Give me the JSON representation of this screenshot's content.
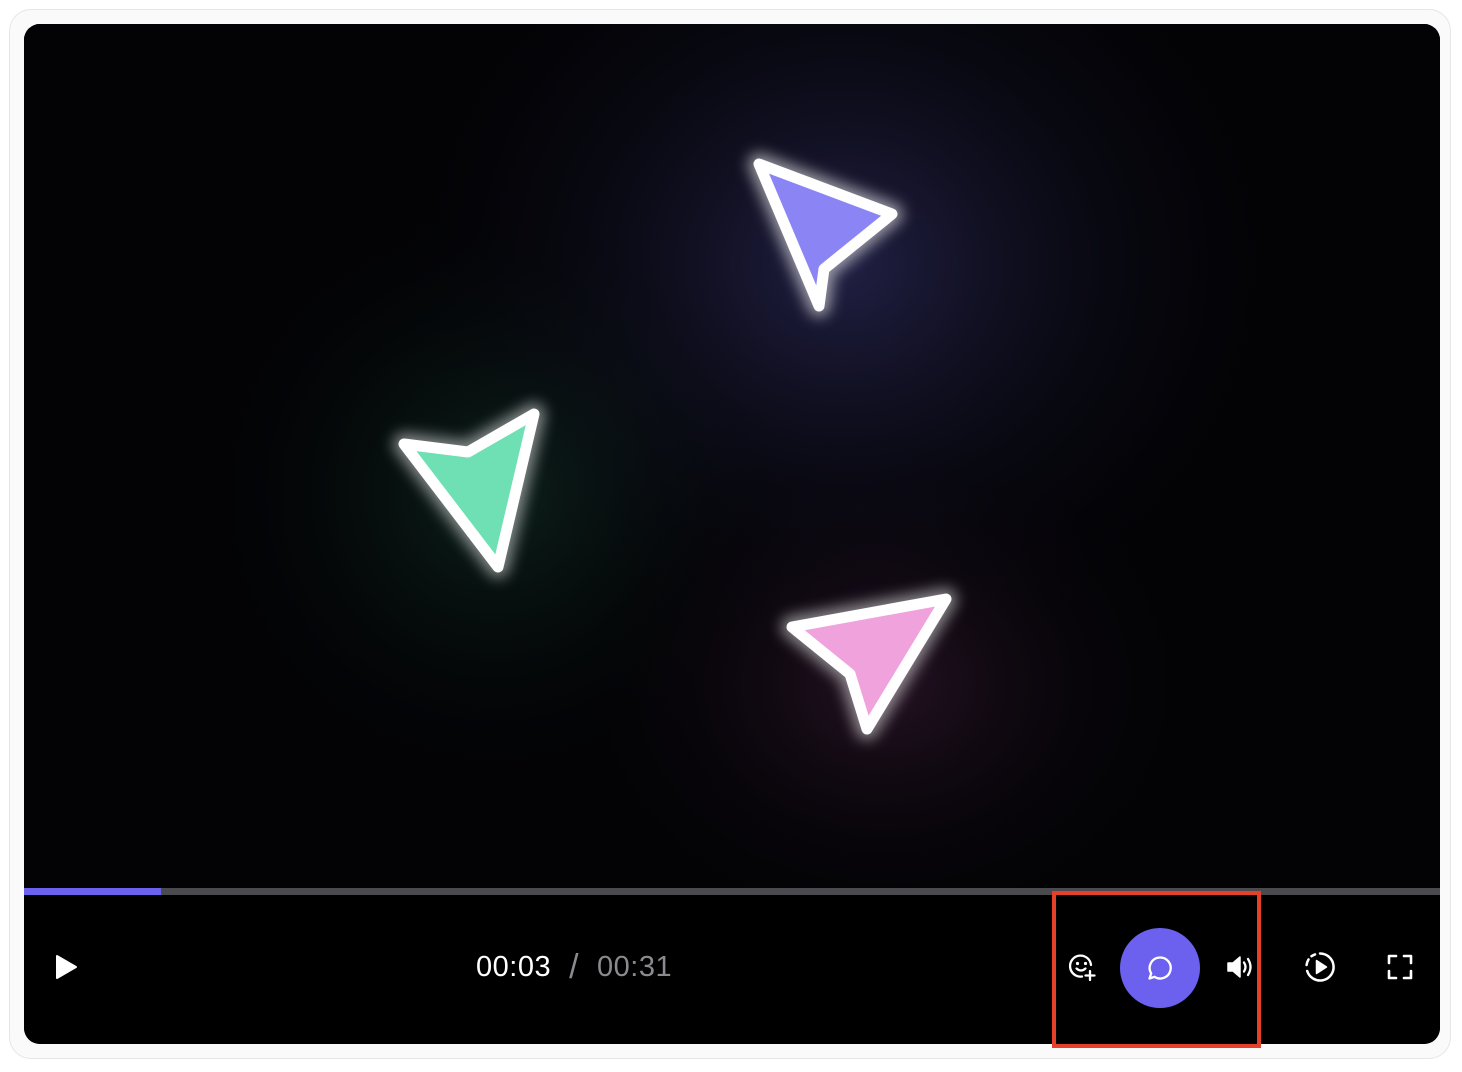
{
  "player": {
    "progress_fraction": 0.097,
    "accent_color": "#6b61ee",
    "time": {
      "current": "00:03",
      "separator": "/",
      "duration": "00:31"
    },
    "video_frame": {
      "cursors": [
        {
          "color": "#8b84f5",
          "icon": "cursor-arrow-purple"
        },
        {
          "color": "#6ee0b4",
          "icon": "cursor-arrow-green"
        },
        {
          "color": "#f0a2dc",
          "icon": "cursor-arrow-pink"
        }
      ]
    },
    "controls": [
      {
        "icon": "play-icon"
      },
      {
        "icon": "add-reaction-icon"
      },
      {
        "icon": "comment-icon"
      },
      {
        "icon": "volume-icon"
      },
      {
        "icon": "playback-speed-icon"
      },
      {
        "icon": "fullscreen-icon"
      }
    ],
    "highlight_color": "#e5402a"
  }
}
